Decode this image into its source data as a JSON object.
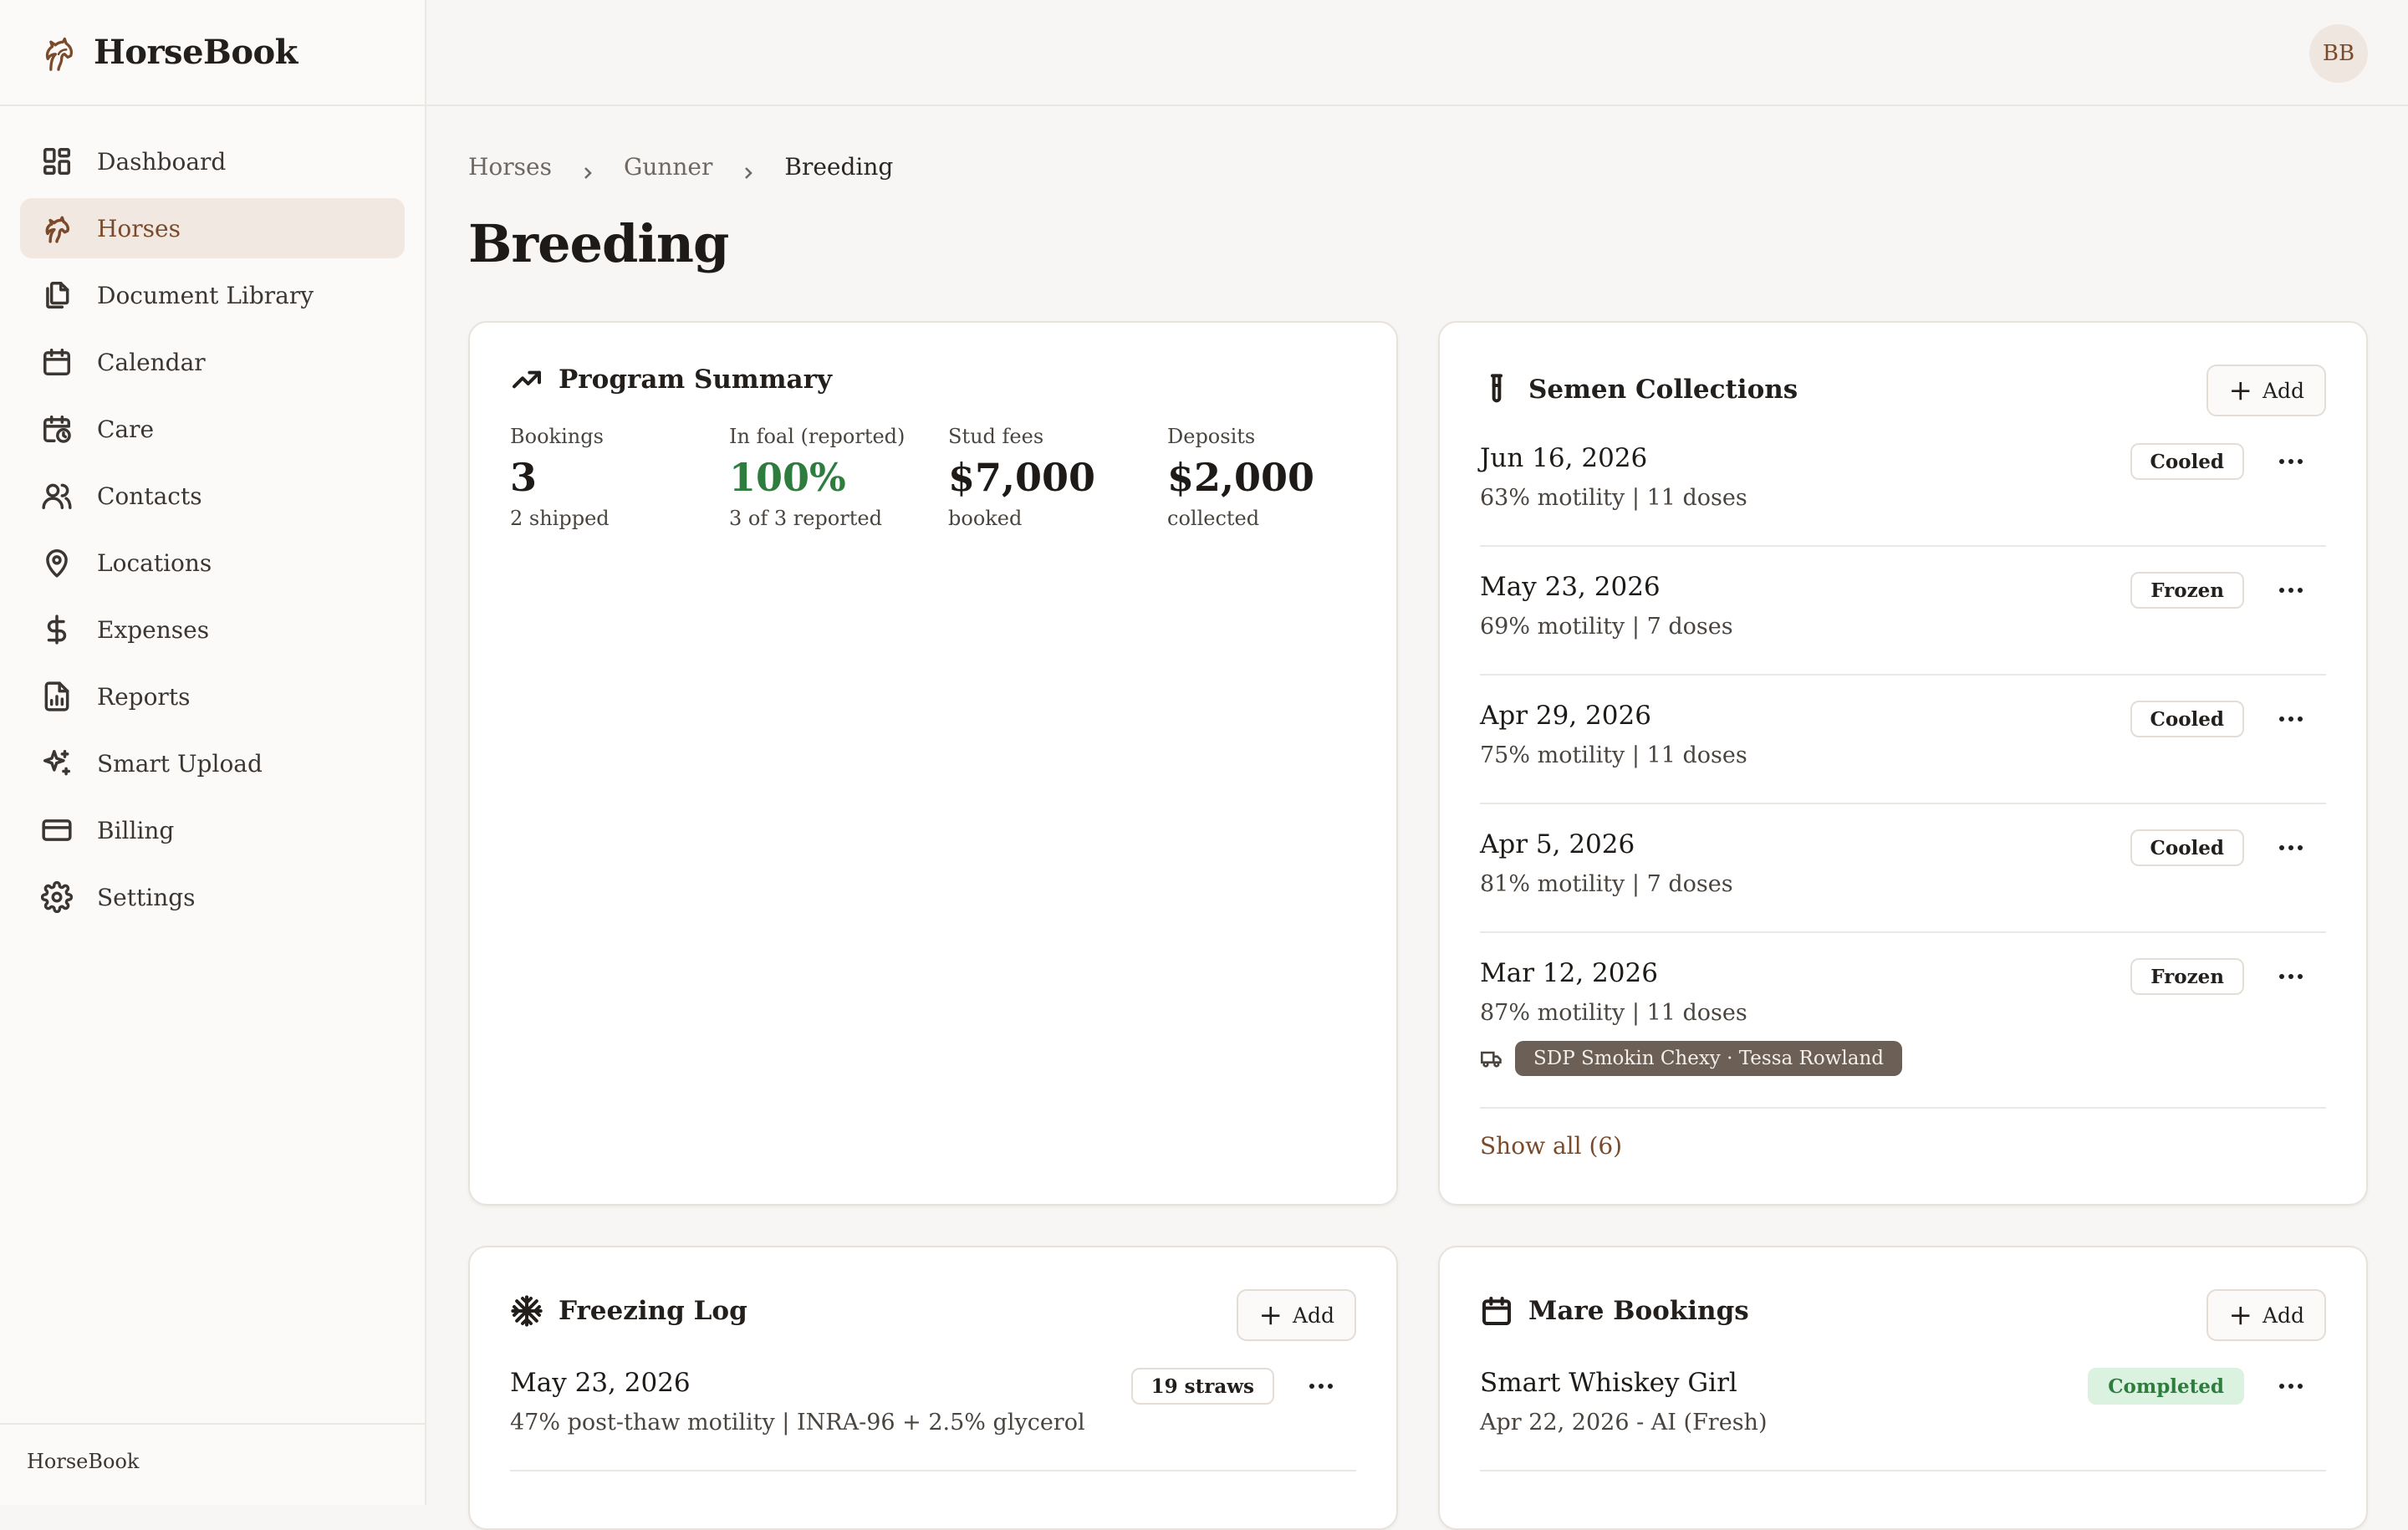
{
  "app": {
    "name": "HorseBook",
    "footer": "HorseBook",
    "user_initials": "BB"
  },
  "nav": [
    {
      "label": "Dashboard",
      "icon": "dashboard-icon",
      "active": false
    },
    {
      "label": "Horses",
      "icon": "horse-icon",
      "active": true
    },
    {
      "label": "Document Library",
      "icon": "documents-icon",
      "active": false
    },
    {
      "label": "Calendar",
      "icon": "calendar-icon",
      "active": false
    },
    {
      "label": "Care",
      "icon": "calendar-clock-icon",
      "active": false
    },
    {
      "label": "Contacts",
      "icon": "contacts-icon",
      "active": false
    },
    {
      "label": "Locations",
      "icon": "map-pin-icon",
      "active": false
    },
    {
      "label": "Expenses",
      "icon": "dollar-icon",
      "active": false
    },
    {
      "label": "Reports",
      "icon": "report-icon",
      "active": false
    },
    {
      "label": "Smart Upload",
      "icon": "sparkles-icon",
      "active": false
    },
    {
      "label": "Billing",
      "icon": "credit-card-icon",
      "active": false
    },
    {
      "label": "Settings",
      "icon": "gear-icon",
      "active": false
    }
  ],
  "breadcrumb": [
    "Horses",
    "Gunner",
    "Breeding"
  ],
  "page_title": "Breeding",
  "program_summary": {
    "title": "Program Summary",
    "stats": [
      {
        "label": "Bookings",
        "value": "3",
        "sub": "2 shipped"
      },
      {
        "label": "In foal (reported)",
        "value": "100%",
        "sub": "3 of 3 reported"
      },
      {
        "label": "Stud fees",
        "value": "$7,000",
        "sub": "booked"
      },
      {
        "label": "Deposits",
        "value": "$2,000",
        "sub": "collected"
      }
    ]
  },
  "semen_collections": {
    "title": "Semen Collections",
    "add_label": "Add",
    "items": [
      {
        "date": "Jun 16, 2026",
        "meta": "63% motility | 11 doses",
        "badge": "Cooled"
      },
      {
        "date": "May 23, 2026",
        "meta": "69% motility | 7 doses",
        "badge": "Frozen"
      },
      {
        "date": "Apr 29, 2026",
        "meta": "75% motility | 11 doses",
        "badge": "Cooled"
      },
      {
        "date": "Apr 5, 2026",
        "meta": "81% motility | 7 doses",
        "badge": "Cooled"
      },
      {
        "date": "Mar 12, 2026",
        "meta": "87% motility | 11 doses",
        "badge": "Frozen",
        "shipment": "SDP Smokin Chexy · Tessa Rowland"
      }
    ],
    "show_all": "Show all (6)"
  },
  "freezing_log": {
    "title": "Freezing Log",
    "add_label": "Add",
    "items": [
      {
        "date": "May 23, 2026",
        "meta": "47% post-thaw motility | INRA-96 + 2.5% glycerol",
        "badge": "19 straws"
      }
    ]
  },
  "mare_bookings": {
    "title": "Mare Bookings",
    "add_label": "Add",
    "items": [
      {
        "name": "Smart Whiskey Girl",
        "meta": "Apr 22, 2026 - AI (Fresh)",
        "badge": "Completed"
      }
    ]
  }
}
